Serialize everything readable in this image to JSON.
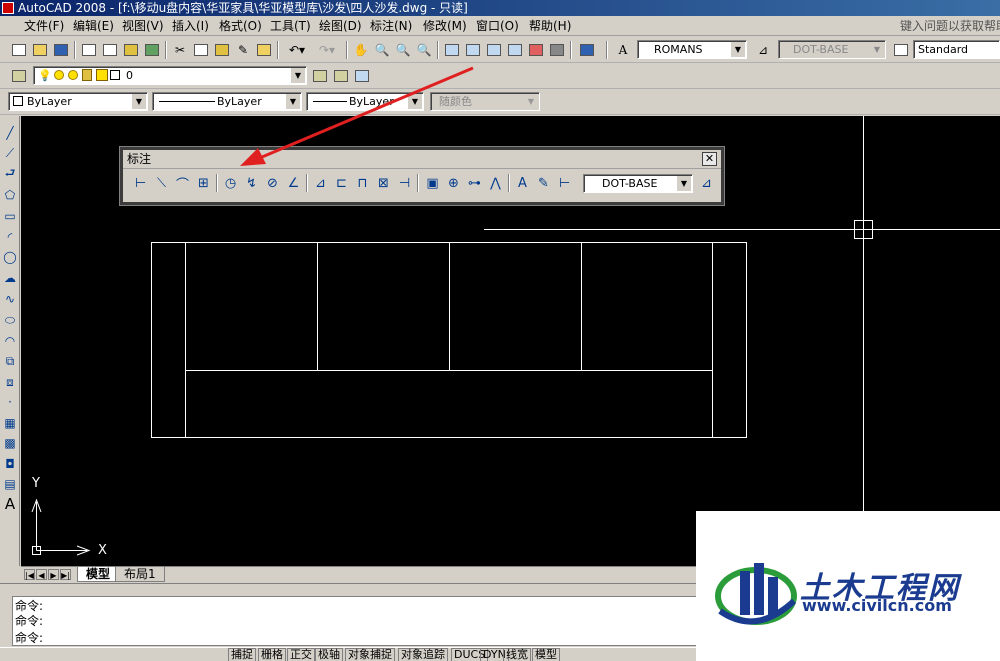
{
  "window": {
    "title": "AutoCAD 2008 - [f:\\移动u盘内容\\华亚家具\\华亚模型库\\沙发\\四人沙发.dwg - 只读]"
  },
  "menubar": {
    "items": [
      "文件(F)",
      "编辑(E)",
      "视图(V)",
      "插入(I)",
      "格式(O)",
      "工具(T)",
      "绘图(D)",
      "标注(N)",
      "修改(M)",
      "窗口(O)",
      "帮助(H)"
    ],
    "help_search": "键入问题以获取帮助"
  },
  "standard_toolbar": {
    "text_style": "ROMANS",
    "dim_style": "DOT-BASE",
    "table_style": "Standard"
  },
  "layers_toolbar": {
    "current_layer": "0"
  },
  "properties_toolbar": {
    "color": "ByLayer",
    "linetype": "ByLayer",
    "lineweight": "ByLayer",
    "plot_style": "随颜色"
  },
  "dimension_toolbar": {
    "title": "标注",
    "dim_style": "DOT-BASE",
    "close_glyph": "✕"
  },
  "ucs": {
    "x_label": "X",
    "y_label": "Y"
  },
  "tabs": {
    "model": "模型",
    "layout1": "布局1"
  },
  "command": {
    "lines": [
      "命令:",
      "命令:",
      "命令:"
    ]
  },
  "statusbar": {
    "items": [
      "捕捉",
      "栅格",
      "正交",
      "极轴",
      "对象捕捉",
      "对象追踪",
      "DUCS",
      "DYN",
      "线宽",
      "模型"
    ]
  },
  "watermark": {
    "name": "土木工程网",
    "url": "www.civilcn.com"
  },
  "colors": {
    "canvas": "#000000",
    "title_start": "#0a246a",
    "title_end": "#3a6ea5",
    "annotation_arrow": "#e02020",
    "watermark_blue": "#1a3b8f"
  }
}
